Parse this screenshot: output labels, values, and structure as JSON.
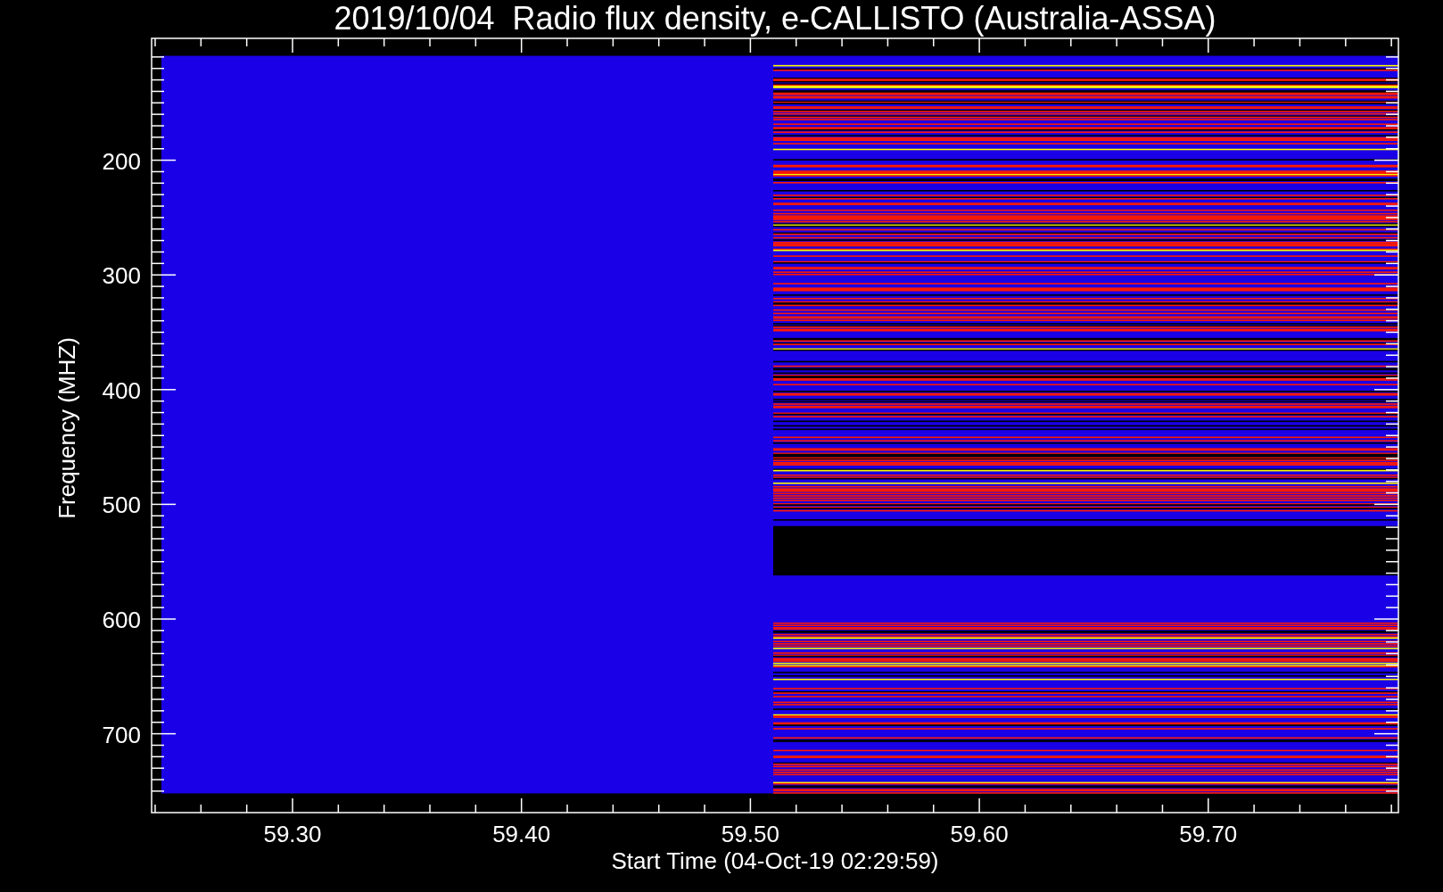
{
  "title": "2019/10/04  Radio flux density, e-CALLISTO (Australia-ASSA)",
  "plot": {
    "xlabel": "Start Time (04-Oct-19 02:29:59)",
    "ylabel": "Frequency (MHZ)",
    "xticks": [
      "59.30",
      "59.40",
      "59.50",
      "59.60",
      "59.70"
    ],
    "yticks": [
      "200",
      "300",
      "400",
      "500",
      "600",
      "700"
    ]
  }
}
